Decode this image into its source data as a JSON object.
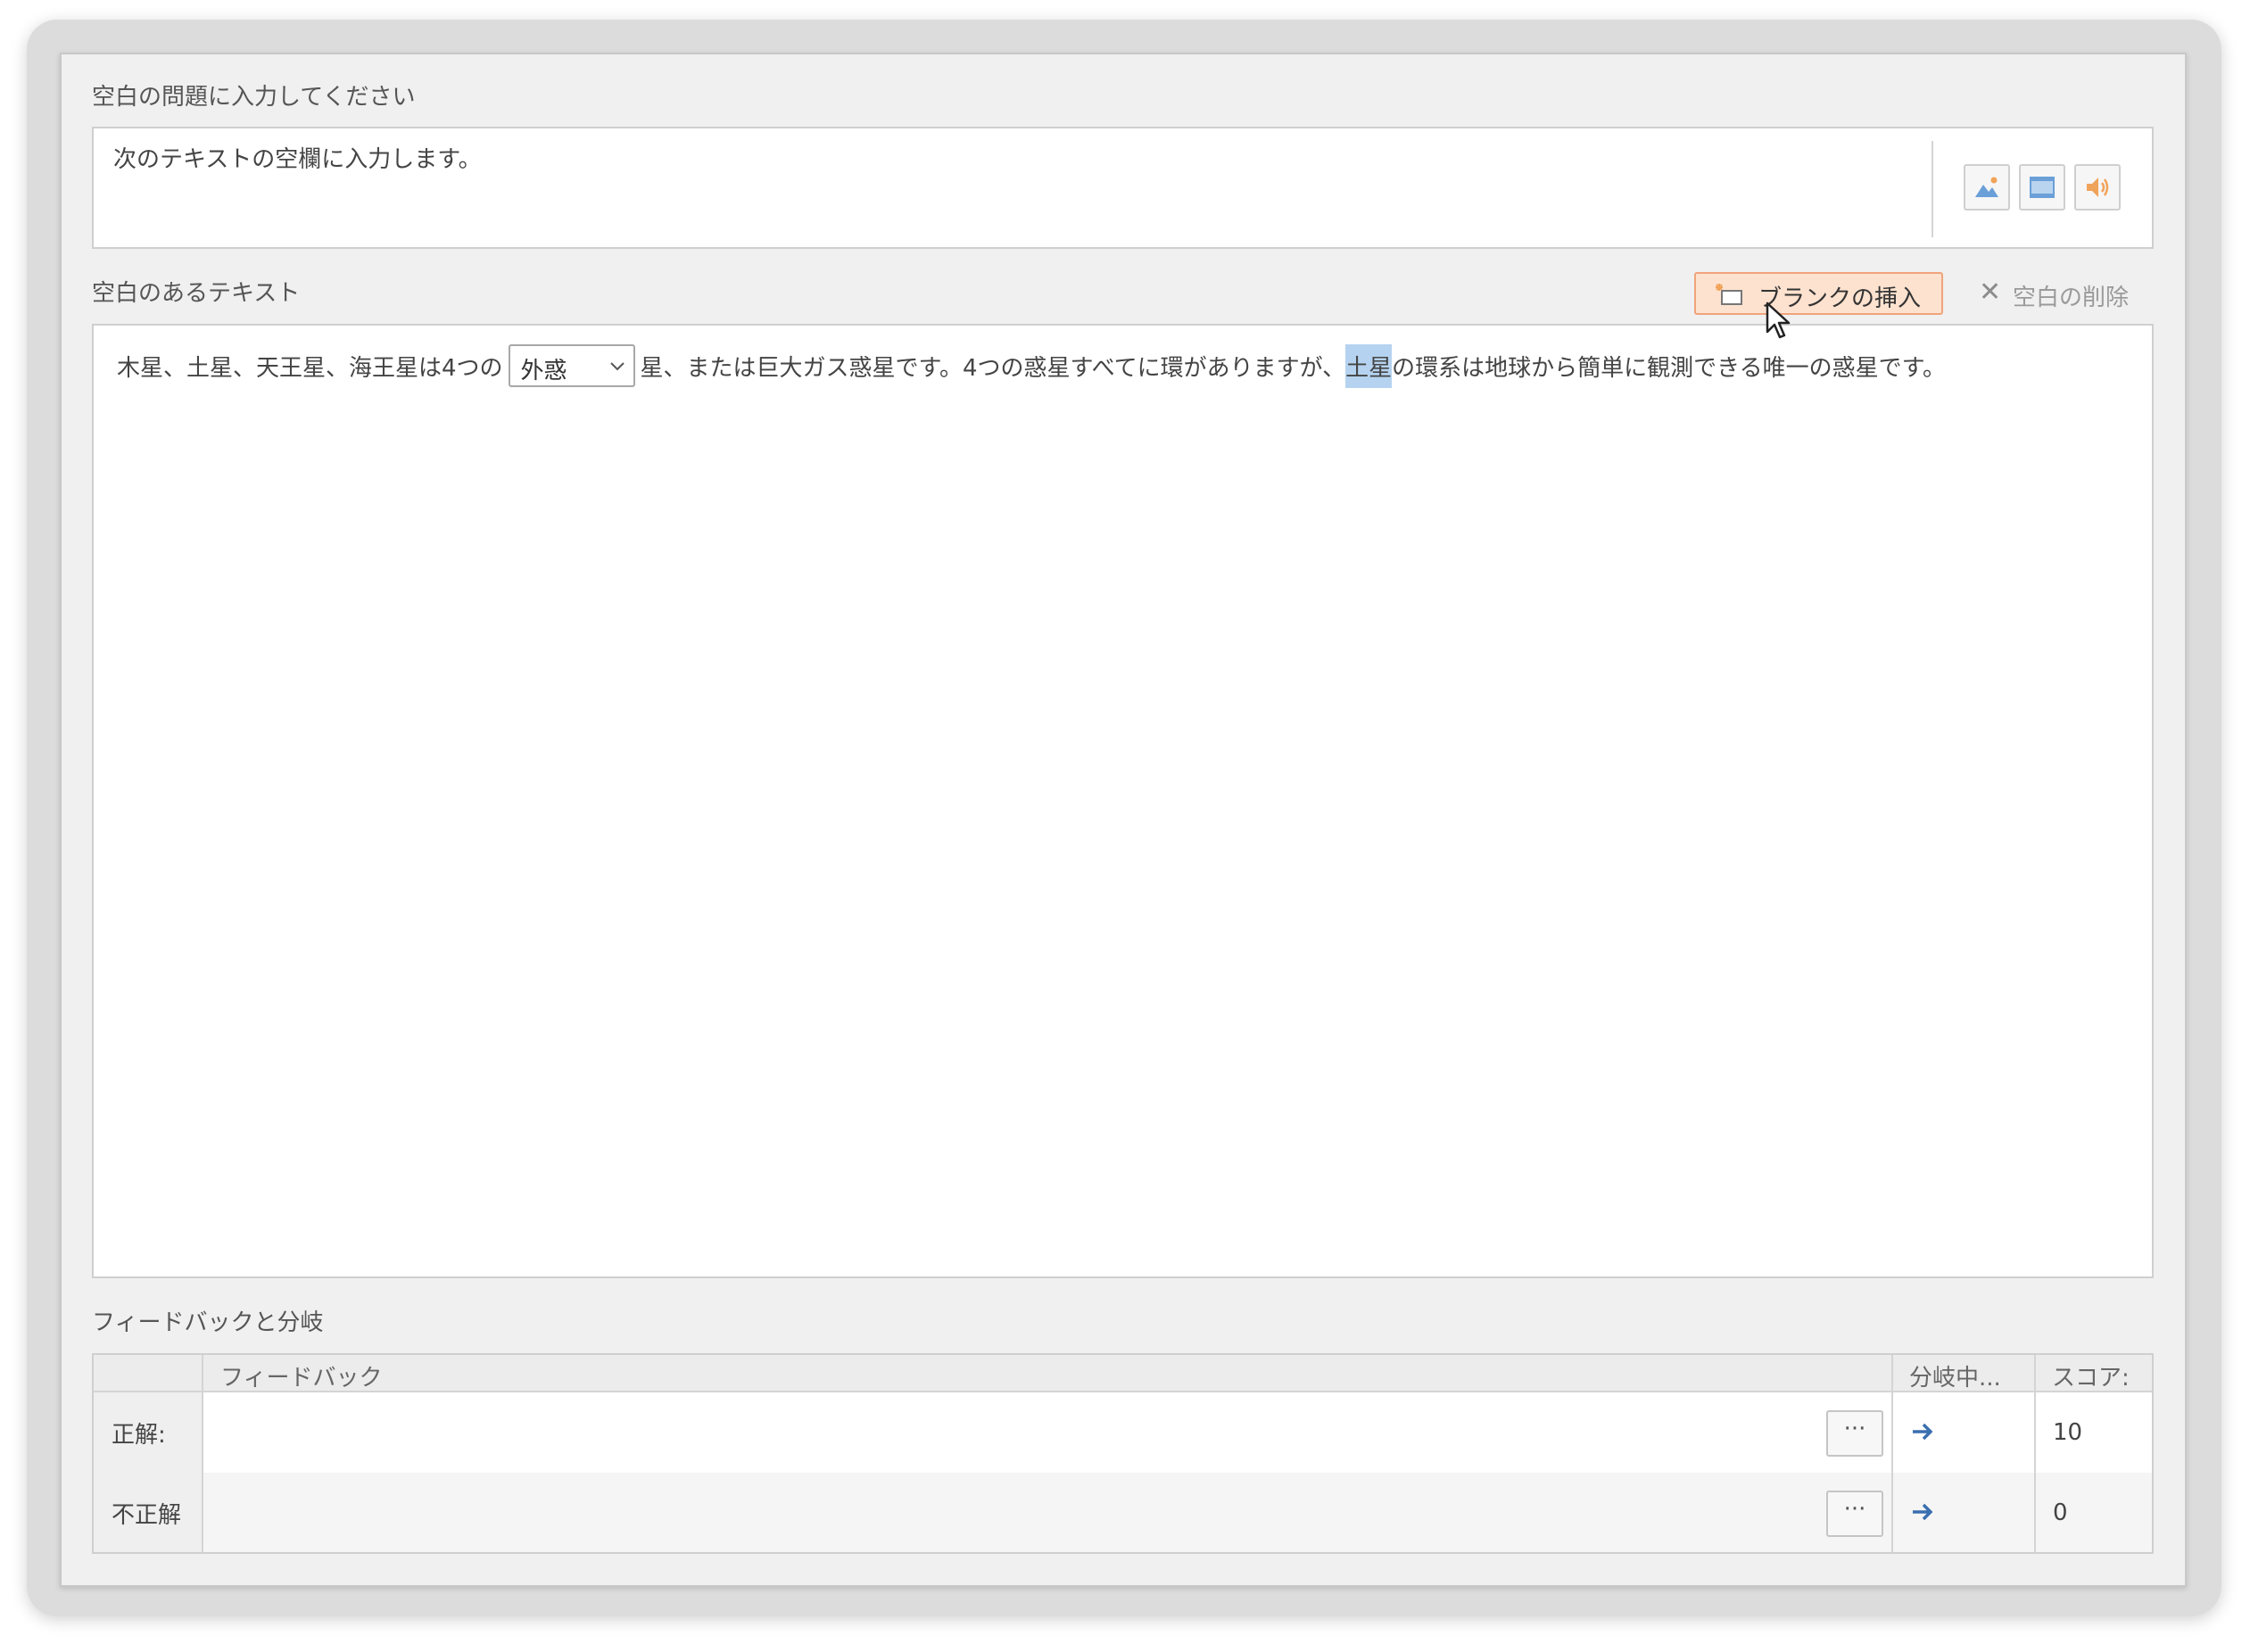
{
  "question_section": {
    "label": "空白の問題に入力してください",
    "text": "次のテキストの空欄に入力します。"
  },
  "media_buttons": [
    "image-icon",
    "video-icon",
    "audio-icon"
  ],
  "text_section": {
    "label": "空白のあるテキスト",
    "insert_blank": "ブランクの挿入",
    "delete_blank": "空白の削除",
    "sentence_before": "木星、土星、天王星、海王星は4つの",
    "blank_value": "外惑",
    "sentence_middle": "星、または巨大ガス惑星です。4つの惑星すべてに環がありますが、",
    "selected_word": "土星",
    "sentence_after": "の環系は地球から簡単に観測できる唯一の惑星です。"
  },
  "feedback_section": {
    "label": "フィードバックと分岐",
    "columns": {
      "feedback": "フィードバック",
      "branch": "分岐中...",
      "score": "スコア:"
    },
    "rows": [
      {
        "label": "正解:",
        "more": "···",
        "score": "10"
      },
      {
        "label": "不正解",
        "more": "···",
        "score": "0"
      }
    ]
  },
  "colors": {
    "accent_insert_bg": "#fde2cf",
    "accent_insert_border": "#f0a37a",
    "selection": "#b5d3f0",
    "arrow": "#3a6fb0"
  }
}
